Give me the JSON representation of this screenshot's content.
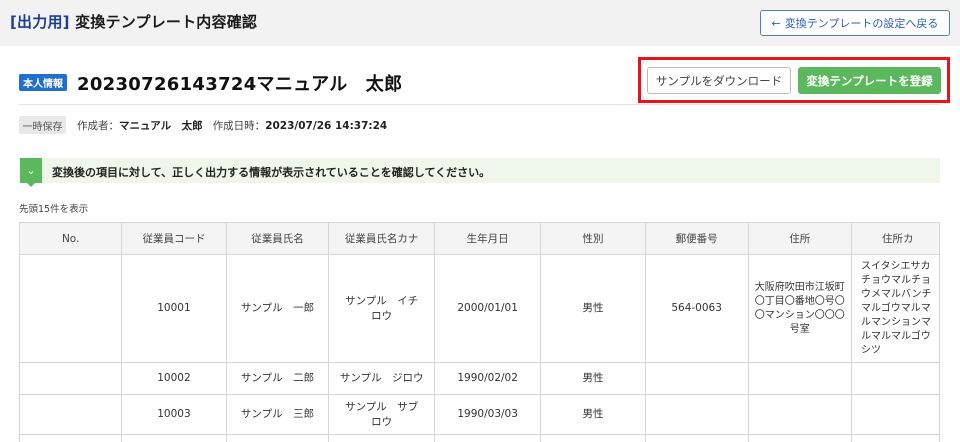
{
  "header": {
    "title_bracket": "[出力用]",
    "title_rest": " 変換テンプレート内容確認",
    "back_button_label": "変換テンプレートの設定へ戻る"
  },
  "template": {
    "badge": "本人情報",
    "name": "20230726143724マニュアル　太郎",
    "download_button_label": "サンプルをダウンロード",
    "register_button_label": "変換テンプレートを登録"
  },
  "meta": {
    "status_badge": "一時保存",
    "creator_label": "作成者：",
    "creator_value": "マニュアル　太郎",
    "created_label": "作成日時：",
    "created_value": "2023/07/26 14:37:24"
  },
  "notice": {
    "text": "変換後の項目に対して、正しく出力する情報が表示されていることを確認してください。"
  },
  "count_text": "先頭15件を表示",
  "table": {
    "headers": [
      "No.",
      "従業員コード",
      "従業員氏名",
      "従業員氏名カナ",
      "生年月日",
      "性別",
      "郵便番号",
      "住所",
      "住所カ"
    ],
    "rows": [
      [
        "",
        "10001",
        "サンプル　一郎",
        "サンプル　イチロウ",
        "2000/01/01",
        "男性",
        "564-0063",
        "大阪府吹田市江坂町〇丁目〇番地〇号〇〇マンション〇〇〇号室",
        "スイタシエサカチョウマルチョウメマルバンチマルゴウマルマルマンションマルマルマルゴウシツ"
      ],
      [
        "",
        "10002",
        "サンプル　二郎",
        "サンプル　ジロウ",
        "1990/02/02",
        "男性",
        "",
        "",
        ""
      ],
      [
        "",
        "10003",
        "サンプル　三郎",
        "サンプル　サブロウ",
        "1990/03/03",
        "男性",
        "",
        "",
        ""
      ],
      [
        "",
        "",
        "",
        "",
        "",
        "",
        "",
        "",
        ""
      ]
    ]
  },
  "colors": {
    "accent_blue": "#1f6fd1",
    "register_green": "#5cb85c",
    "highlight_red": "#e8141c"
  }
}
